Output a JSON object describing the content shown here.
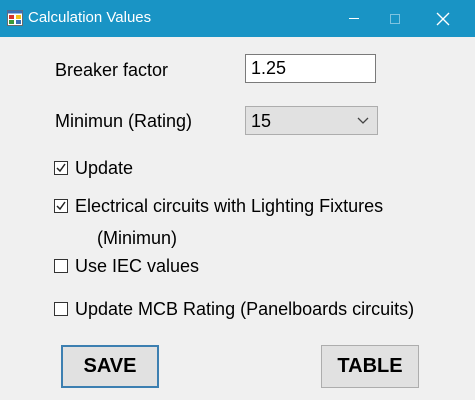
{
  "window": {
    "title": "Calculation Values",
    "icon": "app-window-icon",
    "accent_color": "#1994c5"
  },
  "form": {
    "breaker_factor": {
      "label": "Breaker factor",
      "value": "1.25"
    },
    "minimum_rating": {
      "label": "Minimun (Rating)",
      "selected": "15"
    },
    "checkboxes": [
      {
        "label": "Update",
        "checked": true
      },
      {
        "label": "Electrical circuits with Lighting Fixtures",
        "label_line2": "(Minimun)",
        "checked": true
      },
      {
        "label": "Use IEC values",
        "checked": false
      },
      {
        "label": "Update MCB Rating (Panelboards circuits)",
        "checked": false
      }
    ]
  },
  "buttons": {
    "save": "SAVE",
    "table": "TABLE"
  }
}
